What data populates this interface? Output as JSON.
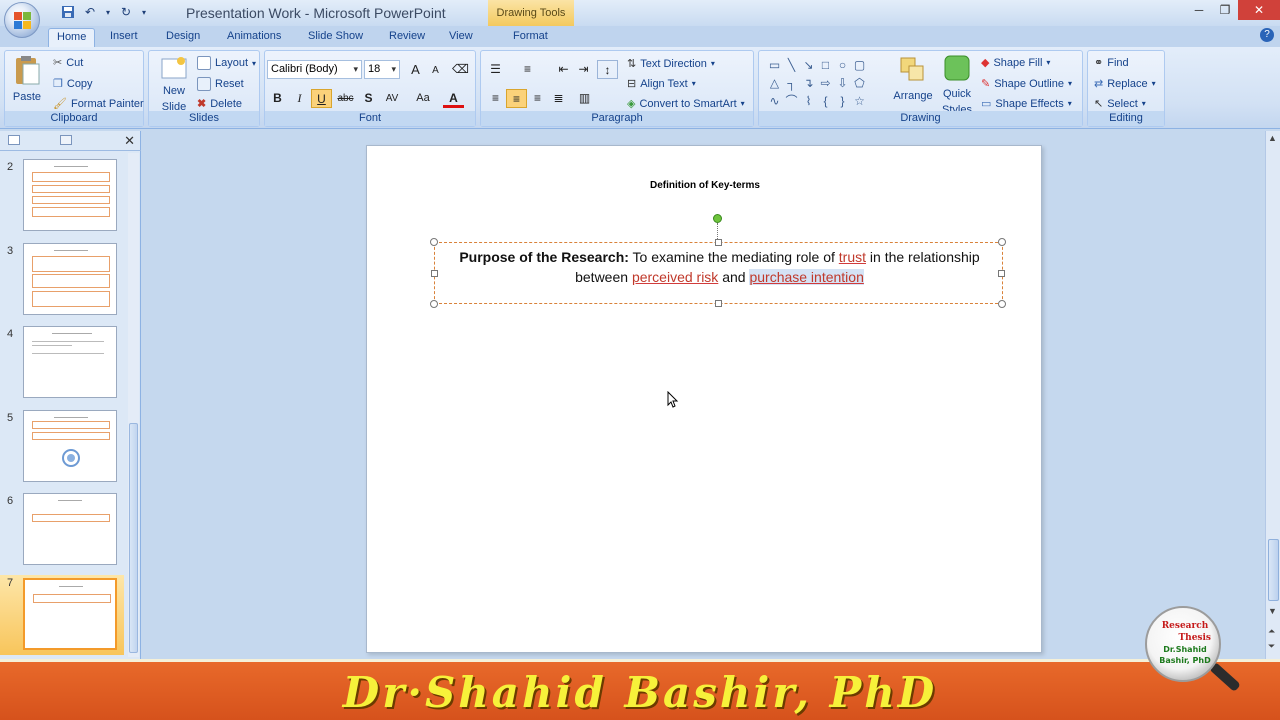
{
  "app": {
    "title": "Presentation Work - Microsoft PowerPoint",
    "contextual_tab_group": "Drawing Tools"
  },
  "tabs": [
    "Home",
    "Insert",
    "Design",
    "Animations",
    "Slide Show",
    "Review",
    "View",
    "Format"
  ],
  "ribbon": {
    "clipboard": {
      "paste": "Paste",
      "cut": "Cut",
      "copy": "Copy",
      "format_painter": "Format Painter",
      "label": "Clipboard"
    },
    "slides": {
      "new_slide": "New Slide",
      "new_slide_line1": "New",
      "new_slide_line2": "Slide",
      "layout": "Layout",
      "reset": "Reset",
      "delete": "Delete",
      "label": "Slides"
    },
    "font": {
      "font_name": "Calibri (Body)",
      "font_size": "18",
      "label": "Font",
      "bold": "B",
      "italic": "I",
      "underline": "U",
      "strike": "abc",
      "shadow": "S",
      "spacing": "AV",
      "case": "Aa",
      "color": "A",
      "grow": "A",
      "shrink": "A"
    },
    "paragraph": {
      "text_direction": "Text Direction",
      "align_text": "Align Text",
      "convert_smartart": "Convert to SmartArt",
      "label": "Paragraph"
    },
    "drawing": {
      "arrange": "Arrange",
      "quick_styles_line1": "Quick",
      "quick_styles_line2": "Styles",
      "shape_fill": "Shape Fill",
      "shape_outline": "Shape Outline",
      "shape_effects": "Shape Effects",
      "label": "Drawing"
    },
    "editing": {
      "find": "Find",
      "replace": "Replace",
      "select": "Select",
      "label": "Editing"
    }
  },
  "thumbnails": [
    {
      "num": "2"
    },
    {
      "num": "3"
    },
    {
      "num": "4"
    },
    {
      "num": "5"
    },
    {
      "num": "6"
    },
    {
      "num": "7",
      "selected": true
    }
  ],
  "slide": {
    "title": "Definition of Key-terms",
    "text": {
      "bold_lead": "Purpose of the Research:",
      "part1": " To examine the mediating role of ",
      "term1": "trust",
      "part2": " in the relationship between ",
      "term2": "perceived risk",
      "part3": " and ",
      "term3": "purchase intention"
    }
  },
  "banner": {
    "text": "Dr·Shahid  Bashir,  PhD",
    "badge_line1": "Research",
    "badge_line2": "Thesis",
    "badge_line3": "Dr.Shahid",
    "badge_line4": "Bashir, PhD"
  },
  "colors": {
    "accent_orange": "#d6521c",
    "banner_text": "#f7f13a",
    "ribbon_blue": "#15428b",
    "underline_red": "#c0392b"
  }
}
